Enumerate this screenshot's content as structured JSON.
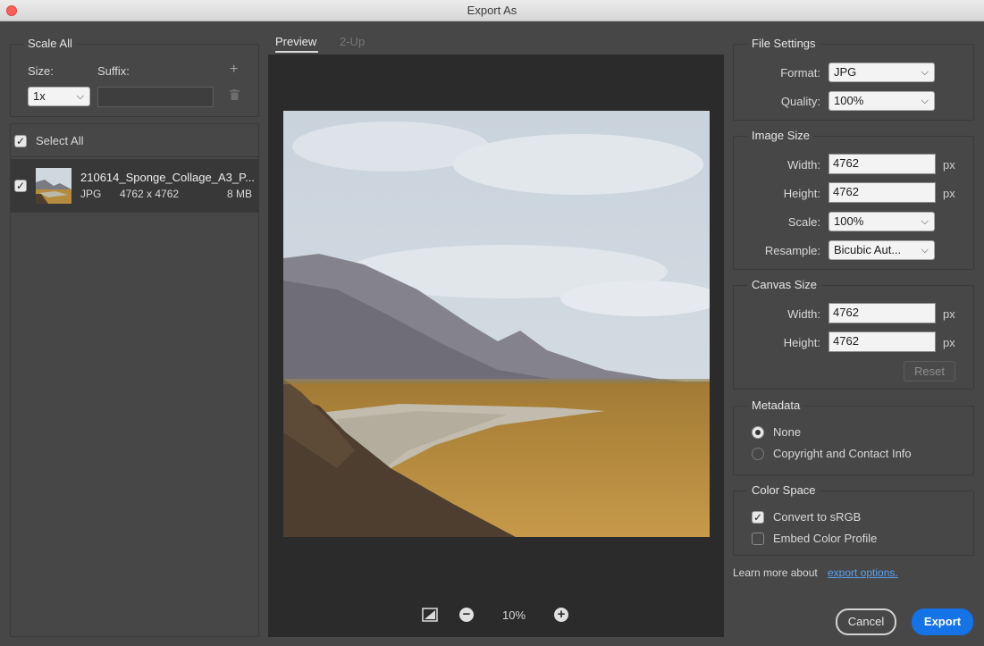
{
  "window": {
    "title": "Export As"
  },
  "left": {
    "scale_all_title": "Scale All",
    "size_label": "Size:",
    "suffix_label": "Suffix:",
    "size_value": "1x",
    "suffix_value": "",
    "add_icon": "plus-icon",
    "delete_icon": "trash-icon",
    "select_all_label": "Select All",
    "file": {
      "name": "210614_Sponge_Collage_A3_P...",
      "format": "JPG",
      "dimensions": "4762 x 4762",
      "size": "8 MB"
    }
  },
  "center": {
    "tabs": [
      {
        "label": "Preview",
        "active": true
      },
      {
        "label": "2-Up",
        "active": false
      }
    ],
    "zoom": "10%"
  },
  "file_settings": {
    "title": "File Settings",
    "format_label": "Format:",
    "format_value": "JPG",
    "quality_label": "Quality:",
    "quality_value": "100%"
  },
  "image_size": {
    "title": "Image Size",
    "width_label": "Width:",
    "width_value": "4762",
    "height_label": "Height:",
    "height_value": "4762",
    "scale_label": "Scale:",
    "scale_value": "100%",
    "resample_label": "Resample:",
    "resample_value": "Bicubic Aut...",
    "unit": "px"
  },
  "canvas_size": {
    "title": "Canvas Size",
    "width_label": "Width:",
    "width_value": "4762",
    "height_label": "Height:",
    "height_value": "4762",
    "unit": "px",
    "reset_label": "Reset"
  },
  "metadata": {
    "title": "Metadata",
    "options": [
      "None",
      "Copyright and Contact Info"
    ],
    "selected": "None"
  },
  "color_space": {
    "title": "Color Space",
    "convert_label": "Convert to sRGB",
    "convert_checked": true,
    "embed_label": "Embed Color Profile",
    "embed_checked": false
  },
  "footer": {
    "learn_text": "Learn more about",
    "learn_link": "export options.",
    "cancel_label": "Cancel",
    "export_label": "Export"
  },
  "colors": {
    "dialog_bg": "#474747",
    "preview_bg": "#2b2b2b",
    "accent": "#1473e6",
    "link": "#5aa0f0"
  }
}
